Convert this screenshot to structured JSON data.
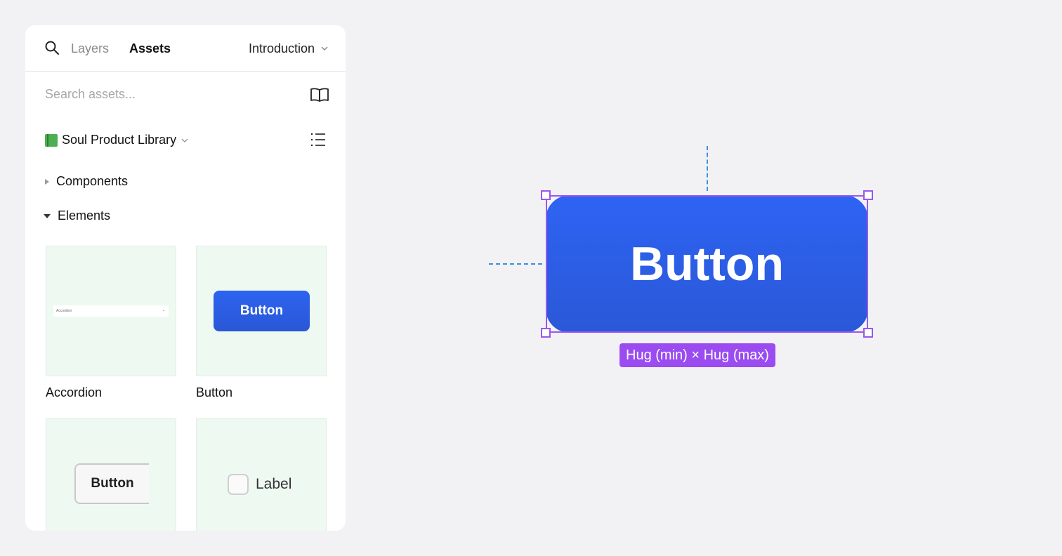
{
  "header": {
    "tabs": [
      {
        "label": "Layers",
        "active": false
      },
      {
        "label": "Assets",
        "active": true
      }
    ],
    "page_select": "Introduction"
  },
  "search": {
    "placeholder": "Search assets...",
    "value": ""
  },
  "library": {
    "name": "Soul Product Library"
  },
  "tree": [
    {
      "label": "Components",
      "expanded": false
    },
    {
      "label": "Elements",
      "expanded": true
    }
  ],
  "cards": [
    {
      "label": "Accordion",
      "preview_text": "Accordion"
    },
    {
      "label": "Button",
      "preview_text": "Button"
    },
    {
      "label": "",
      "preview_text": "Button"
    },
    {
      "label": "",
      "preview_text": "Label"
    }
  ],
  "canvas": {
    "button_label": "Button",
    "size_badge": "Hug (min) × Hug (max)"
  },
  "colors": {
    "primary_button": "#2e63f3",
    "selection": "#9a57ee",
    "guide": "#3a8fe5",
    "card_bg": "#eefaf1"
  },
  "icons": [
    "search-icon",
    "chevron-down-icon",
    "book-icon",
    "list-icon",
    "triangle-right-icon",
    "triangle-down-icon",
    "green-book-icon"
  ]
}
